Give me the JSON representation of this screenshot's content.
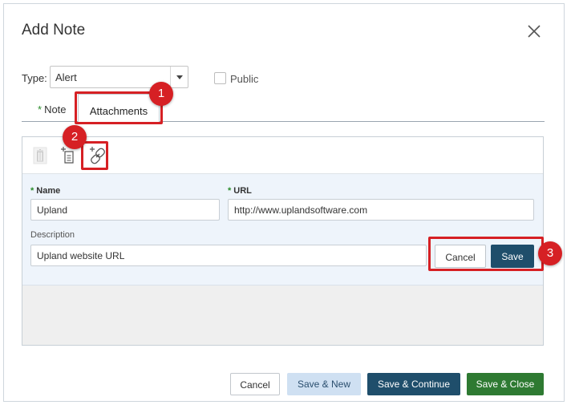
{
  "dialog": {
    "title": "Add Note"
  },
  "type_field": {
    "label": "Type:",
    "value": "Alert"
  },
  "public": {
    "label": "Public",
    "checked": false
  },
  "tabs": [
    {
      "label": "Note",
      "required": true
    },
    {
      "label": "Attachments",
      "active": true
    }
  ],
  "toolbar": {
    "icons": [
      "trash-icon",
      "add-file-icon",
      "add-link-icon"
    ]
  },
  "attachment_form": {
    "name_label": "Name",
    "name_value": "Upland",
    "url_label": "URL",
    "url_value": "http://www.uplandsoftware.com",
    "description_label": "Description",
    "description_value": "Upland website URL",
    "cancel_label": "Cancel",
    "save_label": "Save"
  },
  "footer": {
    "cancel_label": "Cancel",
    "save_new_label": "Save & New",
    "save_continue_label": "Save & Continue",
    "save_close_label": "Save & Close"
  },
  "callouts": [
    "1",
    "2",
    "3"
  ],
  "colors": {
    "primary": "#1f4e6b",
    "success": "#2e7a32",
    "secondary": "#cfe0f2",
    "callout": "#d62024",
    "required_star": "#2a8c2a"
  }
}
